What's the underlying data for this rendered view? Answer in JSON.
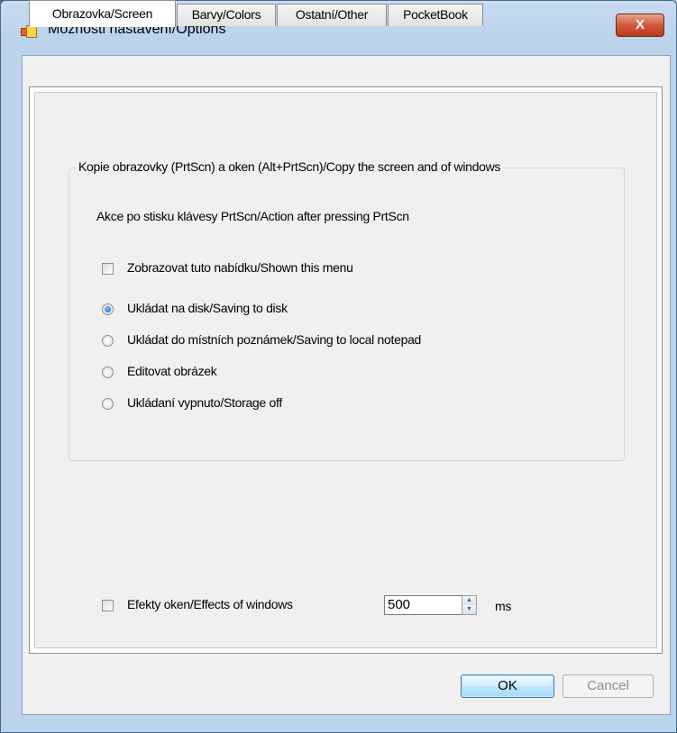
{
  "window": {
    "title": "Možnosti nastavení/Options",
    "close_label": "X"
  },
  "tabs": [
    {
      "label": "Obrazovka/Screen",
      "active": true
    },
    {
      "label": "Barvy/Colors",
      "active": false
    },
    {
      "label": "Ostatní/Other",
      "active": false
    },
    {
      "label": "PocketBook",
      "active": false
    }
  ],
  "screen_tab": {
    "group_title": "Kopie obrazovky (PrtScn) a oken (Alt+PrtScn)/Copy the screen and of windows",
    "action_label": "Akce po stisku klávesy PrtScn/Action after pressing PrtScn",
    "show_menu_checkbox": {
      "label": "Zobrazovat tuto nabídku/Shown this menu",
      "checked": false
    },
    "radio_options": [
      {
        "label": "Ukládat na disk/Saving to disk",
        "checked": true
      },
      {
        "label": "Ukládat do místních poznámek/Saving to local notepad",
        "checked": false
      },
      {
        "label": "Editovat obrázek",
        "checked": false
      },
      {
        "label": "Ukládaní vypnuto/Storage off",
        "checked": false
      }
    ],
    "effects_checkbox": {
      "label": "Efekty oken/Effects of windows",
      "checked": false
    },
    "effects_value": "500",
    "effects_unit": "ms"
  },
  "buttons": {
    "ok": "OK",
    "cancel": "Cancel"
  }
}
